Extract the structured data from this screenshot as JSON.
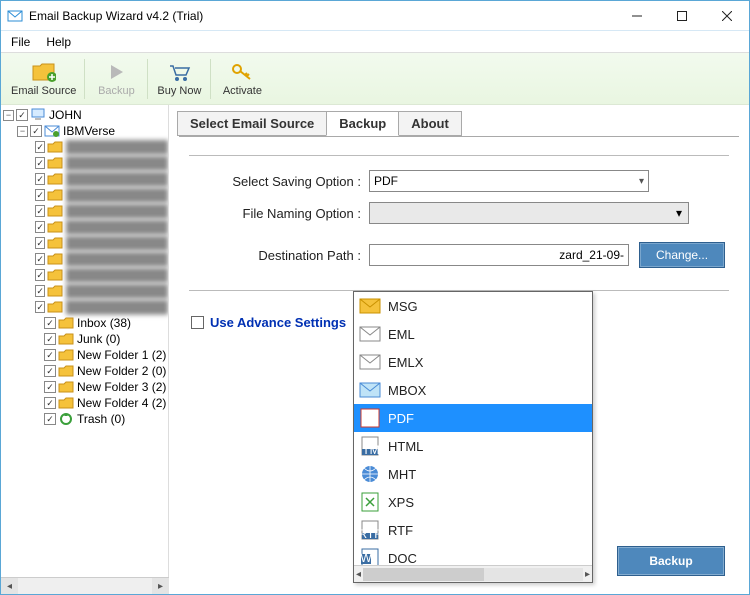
{
  "window": {
    "title": "Email Backup Wizard v4.2 (Trial)"
  },
  "menu": {
    "file": "File",
    "help": "Help"
  },
  "toolbar": {
    "email_source": "Email Source",
    "backup": "Backup",
    "buy_now": "Buy Now",
    "activate": "Activate"
  },
  "tree": {
    "root": "JOHN",
    "account": "IBMVerse",
    "folders": [
      "Inbox (38)",
      "Junk (0)",
      "New Folder 1 (2)",
      "New Folder 2 (0)",
      "New Folder 3 (2)",
      "New Folder 4 (2)",
      "Trash (0)"
    ]
  },
  "tabs": {
    "select_source": "Select Email Source",
    "backup": "Backup",
    "about": "About"
  },
  "form": {
    "saving_label": "Select Saving Option  :",
    "saving_value": "PDF",
    "naming_label": "File Naming Option  :",
    "dest_label": "Destination Path  :",
    "dest_value_fragment": "zard_21-09-",
    "change_btn": "Change...",
    "advance": "Use Advance Settings"
  },
  "dropdown": {
    "options": [
      {
        "label": "MSG"
      },
      {
        "label": "EML"
      },
      {
        "label": "EMLX"
      },
      {
        "label": "MBOX"
      },
      {
        "label": "PDF",
        "selected": true
      },
      {
        "label": "HTML"
      },
      {
        "label": "MHT"
      },
      {
        "label": "XPS"
      },
      {
        "label": "RTF"
      },
      {
        "label": "DOC"
      }
    ]
  },
  "footer": {
    "backup": "Backup"
  }
}
